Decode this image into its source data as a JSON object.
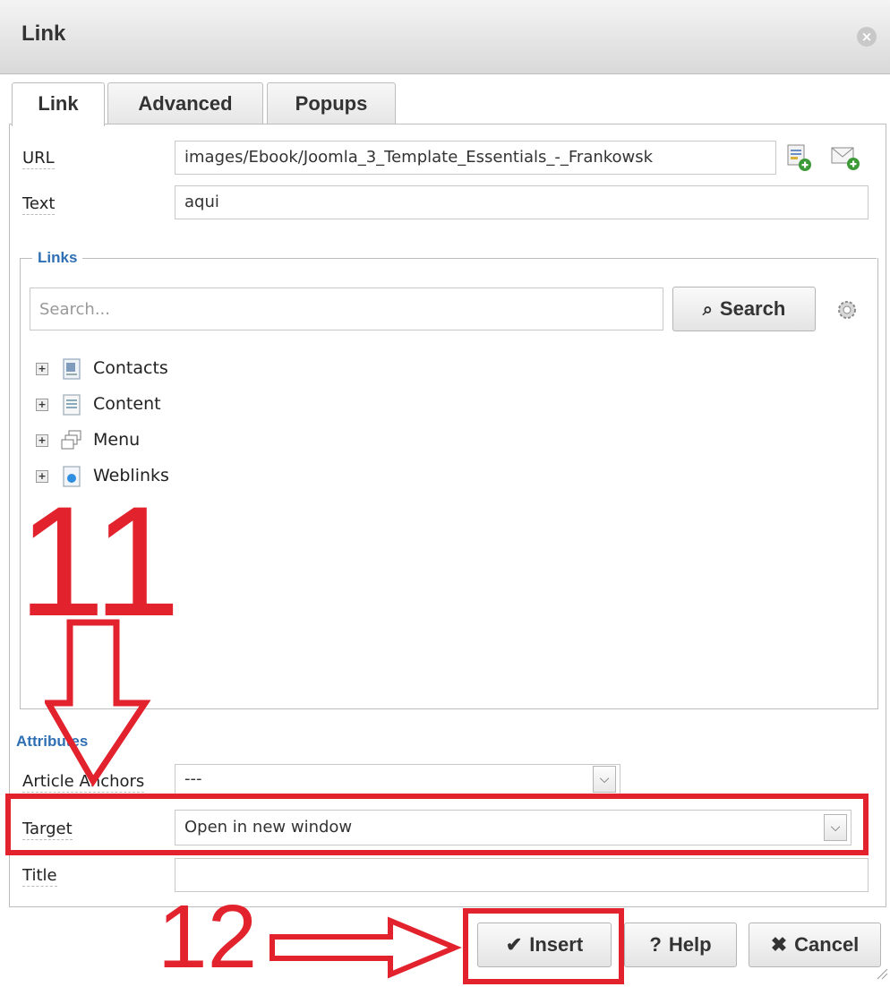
{
  "dialog": {
    "title": "Link"
  },
  "tabs": [
    {
      "label": "Link"
    },
    {
      "label": "Advanced"
    },
    {
      "label": "Popups"
    }
  ],
  "fields": {
    "url_label": "URL",
    "url_value": "images/Ebook/Joomla_3_Template_Essentials_-_Frankowsk",
    "text_label": "Text",
    "text_value": "aqui"
  },
  "links": {
    "legend": "Links",
    "search_placeholder": "Search...",
    "search_button": "Search",
    "tree": [
      {
        "label": "Contacts"
      },
      {
        "label": "Content"
      },
      {
        "label": "Menu"
      },
      {
        "label": "Weblinks"
      }
    ]
  },
  "attributes": {
    "legend": "Attributes",
    "anchors_label": "Article Anchors",
    "anchors_value": "---",
    "target_label": "Target",
    "target_value": "Open in new window",
    "title_label": "Title",
    "title_value": ""
  },
  "buttons": {
    "insert": "Insert",
    "help": "Help",
    "cancel": "Cancel"
  },
  "annotations": {
    "step_a": "11",
    "step_b": "12",
    "color": "#e2222c"
  },
  "icons": {
    "close": "close-icon",
    "browse": "file-browse-icon",
    "email": "email-icon",
    "search": "search-icon",
    "settings": "gear-icon",
    "check": "check-icon"
  }
}
